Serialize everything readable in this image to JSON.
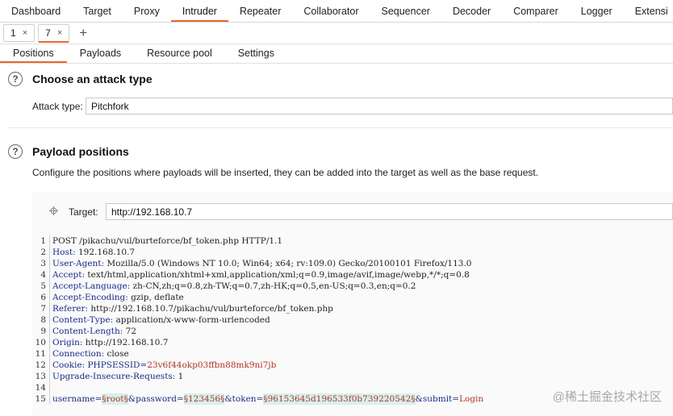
{
  "top_tabs": [
    "Dashboard",
    "Target",
    "Proxy",
    "Intruder",
    "Repeater",
    "Collaborator",
    "Sequencer",
    "Decoder",
    "Comparer",
    "Logger",
    "Extensi"
  ],
  "active_top_tab": "Intruder",
  "sub_tabs": [
    {
      "label": "1",
      "close": "×"
    },
    {
      "label": "7",
      "close": "×"
    }
  ],
  "add_tab": "+",
  "inner_tabs": [
    "Positions",
    "Payloads",
    "Resource pool",
    "Settings"
  ],
  "attack": {
    "title": "Choose an attack type",
    "label": "Attack type:",
    "value": "Pitchfork"
  },
  "payload": {
    "title": "Payload positions",
    "description": "Configure the positions where payloads will be inserted, they can be added into the target as well as the base request.",
    "target_label": "Target:",
    "target_value": "http://192.168.10.7"
  },
  "request_lines": [
    {
      "n": "1",
      "parts": [
        {
          "t": "POST /pikachu/vul/burteforce/bf_token.php HTTP/1.1",
          "c": "hval"
        }
      ]
    },
    {
      "n": "2",
      "parts": [
        {
          "t": "Host:",
          "c": "hname"
        },
        {
          "t": " 192.168.10.7",
          "c": "hval"
        }
      ]
    },
    {
      "n": "3",
      "parts": [
        {
          "t": "User-Agent:",
          "c": "hname"
        },
        {
          "t": " Mozilla/5.0 (Windows NT 10.0; Win64; x64; rv:109.0) Gecko/20100101 Firefox/113.0",
          "c": "hval"
        }
      ]
    },
    {
      "n": "4",
      "parts": [
        {
          "t": "Accept:",
          "c": "hname"
        },
        {
          "t": " text/html,application/xhtml+xml,application/xml;q=0.9,image/avif,image/webp,*/*;q=0.8",
          "c": "hval"
        }
      ]
    },
    {
      "n": "5",
      "parts": [
        {
          "t": "Accept-Language:",
          "c": "hname"
        },
        {
          "t": " zh-CN,zh;q=0.8,zh-TW;q=0.7,zh-HK;q=0.5,en-US;q=0.3,en;q=0.2",
          "c": "hval"
        }
      ]
    },
    {
      "n": "6",
      "parts": [
        {
          "t": "Accept-Encoding:",
          "c": "hname"
        },
        {
          "t": " gzip, deflate",
          "c": "hval"
        }
      ]
    },
    {
      "n": "7",
      "parts": [
        {
          "t": "Referer:",
          "c": "hname"
        },
        {
          "t": " http://192.168.10.7/pikachu/vul/burteforce/bf_token.php",
          "c": "hval"
        }
      ]
    },
    {
      "n": "8",
      "parts": [
        {
          "t": "Content-Type:",
          "c": "hname"
        },
        {
          "t": " application/x-www-form-urlencoded",
          "c": "hval"
        }
      ]
    },
    {
      "n": "9",
      "parts": [
        {
          "t": "Content-Length:",
          "c": "hname"
        },
        {
          "t": " 72",
          "c": "hval"
        }
      ]
    },
    {
      "n": "10",
      "parts": [
        {
          "t": "Origin:",
          "c": "hname"
        },
        {
          "t": " http://192.168.10.7",
          "c": "hval"
        }
      ]
    },
    {
      "n": "11",
      "parts": [
        {
          "t": "Connection:",
          "c": "hname"
        },
        {
          "t": " close",
          "c": "hval"
        }
      ]
    },
    {
      "n": "12",
      "parts": [
        {
          "t": "Cookie:",
          "c": "hname"
        },
        {
          "t": " PHPSESSID=",
          "c": "hname"
        },
        {
          "t": "23v6f44okp03ffbn88mk9ni7jb",
          "c": "red"
        }
      ]
    },
    {
      "n": "13",
      "parts": [
        {
          "t": "Upgrade-Insecure-Requests:",
          "c": "hname"
        },
        {
          "t": " 1",
          "c": "hval"
        }
      ]
    },
    {
      "n": "14",
      "parts": []
    },
    {
      "n": "15",
      "parts": [
        {
          "t": "username=",
          "c": "blue"
        },
        {
          "t": "§root§",
          "c": "hl"
        },
        {
          "t": "&password=",
          "c": "blue"
        },
        {
          "t": "§123456§",
          "c": "hl"
        },
        {
          "t": "&token=",
          "c": "blue"
        },
        {
          "t": "§96153645d196533f0b739220542§",
          "c": "hl"
        },
        {
          "t": "&submit=",
          "c": "blue"
        },
        {
          "t": "Login",
          "c": "red"
        }
      ]
    }
  ],
  "watermark": "@稀土掘金技术社区"
}
